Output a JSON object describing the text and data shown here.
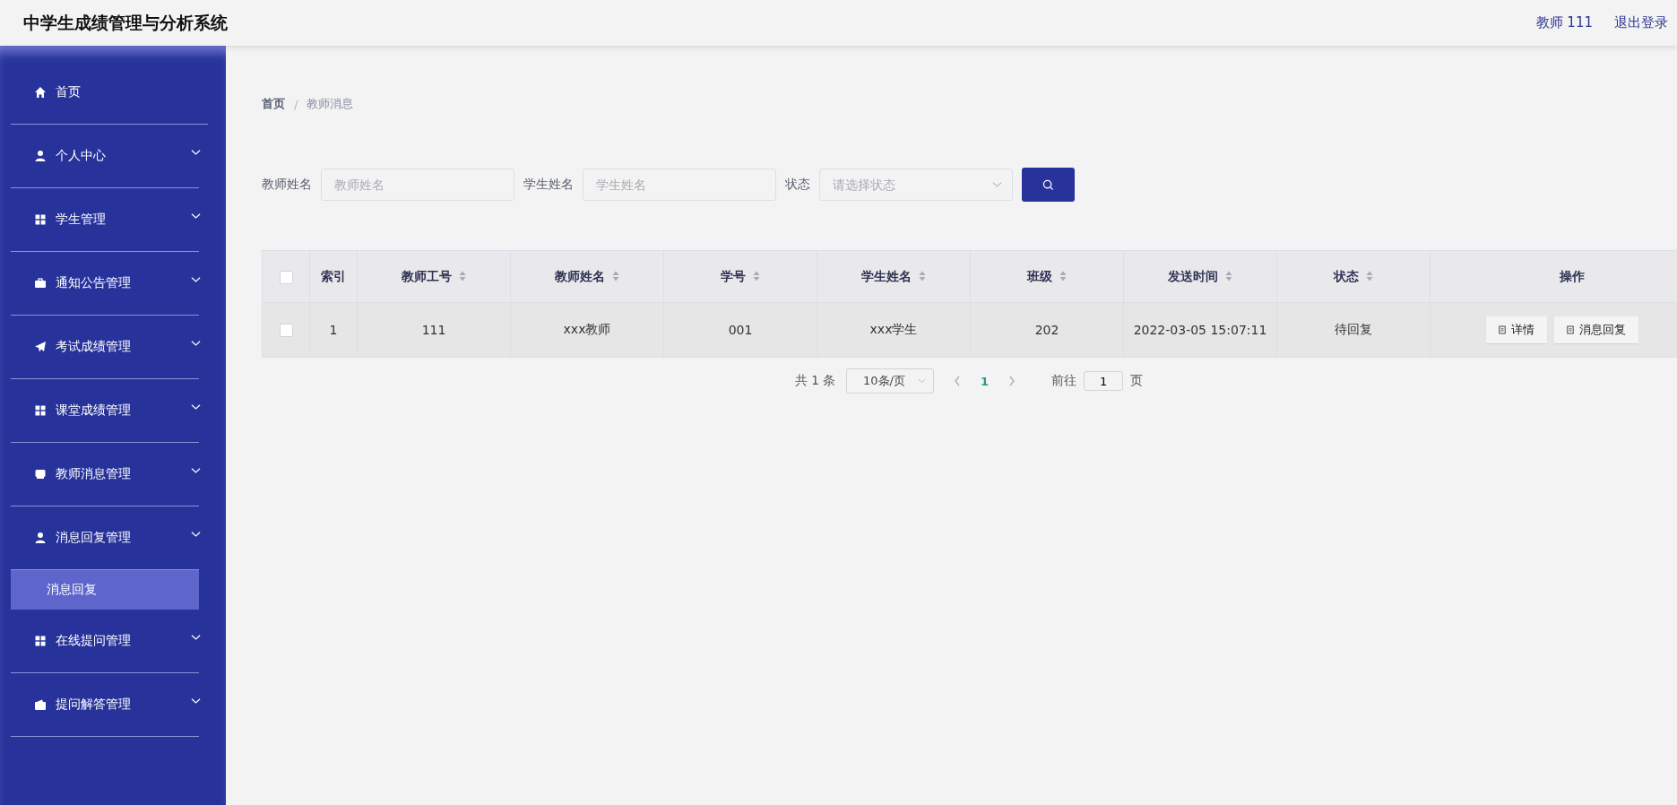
{
  "header": {
    "title": "中学生成绩管理与分析系统",
    "user": "教师 111",
    "logout": "退出登录"
  },
  "sidebar": {
    "items": [
      {
        "label": "首页",
        "kind": "link"
      },
      {
        "label": "个人中心",
        "kind": "group"
      },
      {
        "label": "学生管理",
        "kind": "group"
      },
      {
        "label": "通知公告管理",
        "kind": "group"
      },
      {
        "label": "考试成绩管理",
        "kind": "group"
      },
      {
        "label": "课堂成绩管理",
        "kind": "group"
      },
      {
        "label": "教师消息管理",
        "kind": "group"
      },
      {
        "label": "消息回复管理",
        "kind": "group",
        "expanded": true,
        "children": [
          {
            "label": "消息回复",
            "selected": true
          }
        ]
      },
      {
        "label": "在线提问管理",
        "kind": "group"
      },
      {
        "label": "提问解答管理",
        "kind": "group"
      }
    ]
  },
  "breadcrumb": {
    "separator": "/",
    "items": [
      "首页",
      "教师消息"
    ]
  },
  "search": {
    "fields": [
      {
        "label": "教师姓名",
        "placeholder": "教师姓名",
        "kind": "input"
      },
      {
        "label": "学生姓名",
        "placeholder": "学生姓名",
        "kind": "input"
      },
      {
        "label": "状态",
        "placeholder": "请选择状态",
        "kind": "select"
      }
    ]
  },
  "table": {
    "columns": [
      {
        "label": "索引",
        "sortable": false
      },
      {
        "label": "教师工号",
        "sortable": true
      },
      {
        "label": "教师姓名",
        "sortable": true
      },
      {
        "label": "学号",
        "sortable": true
      },
      {
        "label": "学生姓名",
        "sortable": true
      },
      {
        "label": "班级",
        "sortable": true
      },
      {
        "label": "发送时间",
        "sortable": true
      },
      {
        "label": "状态",
        "sortable": true
      },
      {
        "label": "操作",
        "sortable": false
      }
    ],
    "header_checked": false,
    "rows": [
      {
        "checked": false,
        "cells": [
          "1",
          "111",
          "xxx教师",
          "001",
          "xxx学生",
          "202",
          "2022-03-05 15:07:11",
          "待回复"
        ],
        "actions": [
          "详情",
          "消息回复"
        ]
      }
    ]
  },
  "pagination": {
    "total": "共 1 条",
    "page_size": "10条/页",
    "pages": [
      {
        "label": "1",
        "selected": true
      }
    ],
    "goto_label": "前往",
    "goto_value": "1",
    "goto_suffix": "页"
  }
}
